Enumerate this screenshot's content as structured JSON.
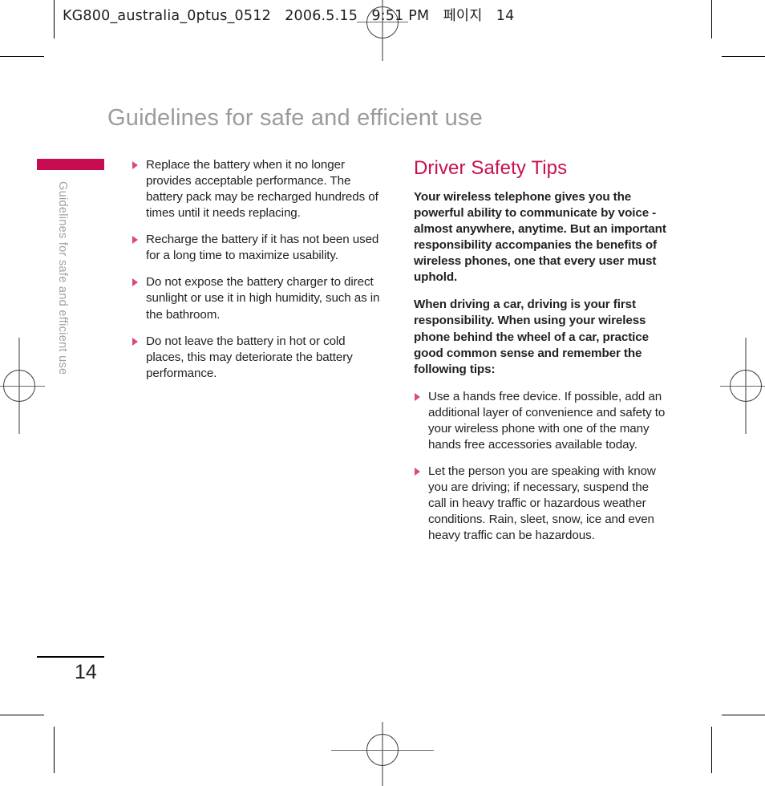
{
  "print_slug": {
    "filename": "KG800_australia_0ptus_0512",
    "date": "2006.5.15",
    "time": "9:51 PM",
    "korean_page_label": "페이지",
    "page_number": "14"
  },
  "page": {
    "title": "Guidelines for safe and efficient use",
    "side_tab_label": "Guidelines for safe and efficient use",
    "folio": "14"
  },
  "colors": {
    "accent_bar": "#c80a50",
    "heading": "#c8104e",
    "bullet": "#d94a7a",
    "title_gray": "#9b9b9b",
    "body": "#231f20"
  },
  "left_column": {
    "bullets": [
      "Replace the battery when it no longer provides acceptable performance. The battery pack may be recharged hundreds of times until it needs replacing.",
      "Recharge the battery if it has not been used for a long time to maximize usability.",
      "Do not expose the battery charger to direct sunlight or use it in high humidity, such as in the bathroom.",
      "Do not leave the battery in hot or cold places, this may deteriorate the battery performance."
    ]
  },
  "right_column": {
    "heading": "Driver Safety Tips",
    "paragraphs": [
      "Your wireless telephone gives you the powerful ability to communicate by voice - almost anywhere, anytime. But an important responsibility accompanies the benefits of wireless phones, one that every user must uphold.",
      "When driving a car, driving is your first responsibility. When using your wireless phone behind the wheel of a car, practice good common sense and remember the following tips:"
    ],
    "bullets": [
      "Use a hands free device. If possible, add an additional layer of convenience and safety to your wireless phone with one of the many hands free accessories available today.",
      "Let the person you are speaking with know you are driving; if necessary, suspend the call in heavy traffic or hazardous weather conditions. Rain, sleet, snow, ice and even heavy traffic can be hazardous."
    ]
  }
}
